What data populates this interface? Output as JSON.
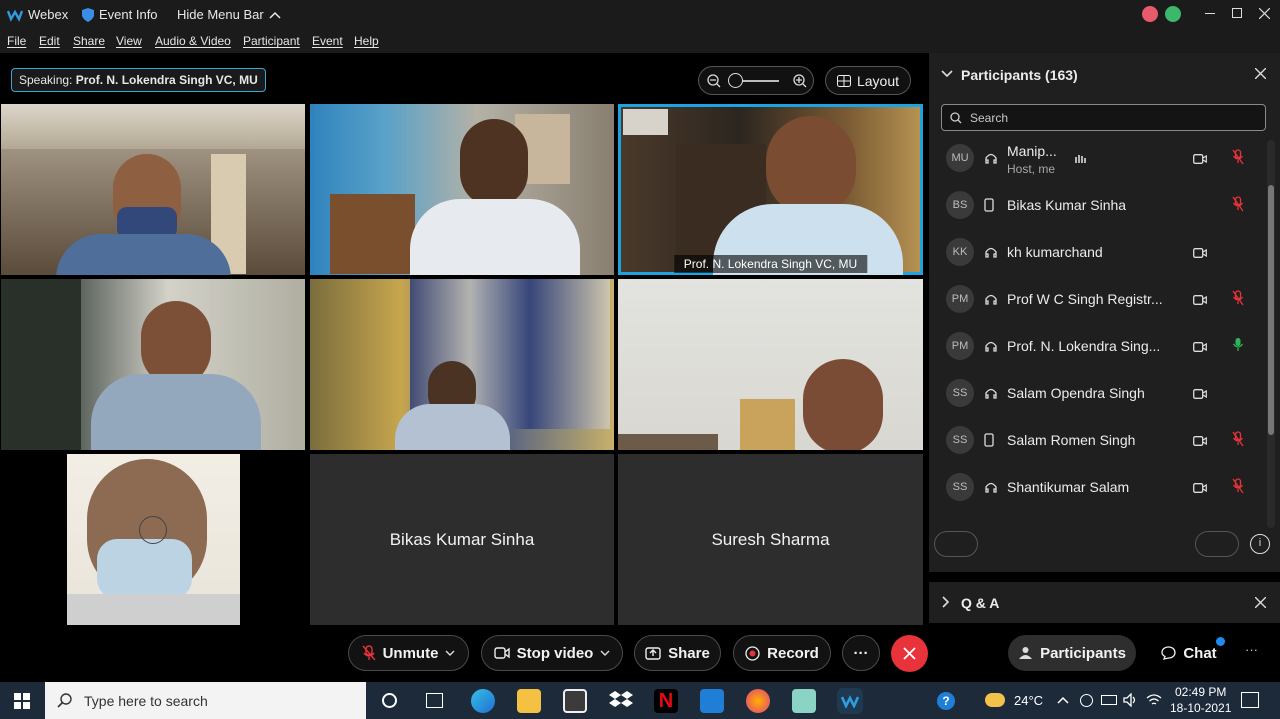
{
  "titlebar": {
    "app_name": "Webex",
    "event_info": "Event Info",
    "hide_menu": "Hide Menu Bar"
  },
  "menu": [
    "File",
    "Edit",
    "Share",
    "View",
    "Audio & Video",
    "Participant",
    "Event",
    "Help"
  ],
  "stage": {
    "speaking_label": "Speaking:",
    "speaking_name": "Prof. N. Lokendra Singh VC, MU",
    "layout_label": "Layout",
    "active_caption": "Prof. N. Lokendra Singh VC, MU",
    "tile_names": [
      "Bikas Kumar Sinha",
      "Suresh Sharma"
    ]
  },
  "participants": {
    "title": "Participants (163)",
    "search_placeholder": "Search",
    "list": [
      {
        "initials": "MU",
        "name": "Manip...",
        "sub": "Host, me",
        "device": "headset",
        "camera": true,
        "mic": "muted"
      },
      {
        "initials": "BS",
        "name": "Bikas Kumar Sinha",
        "sub": "",
        "device": "phone",
        "camera": false,
        "mic": "muted"
      },
      {
        "initials": "KK",
        "name": "kh kumarchand",
        "sub": "",
        "device": "headset",
        "camera": true,
        "mic": "none"
      },
      {
        "initials": "PM",
        "name": "Prof W C Singh Registr...",
        "sub": "",
        "device": "headset",
        "camera": true,
        "mic": "muted"
      },
      {
        "initials": "PM",
        "name": "Prof. N. Lokendra Sing...",
        "sub": "",
        "device": "headset",
        "camera": true,
        "mic": "active"
      },
      {
        "initials": "SS",
        "name": "Salam Opendra Singh",
        "sub": "",
        "device": "headset",
        "camera": true,
        "mic": "none"
      },
      {
        "initials": "SS",
        "name": "Salam Romen Singh",
        "sub": "",
        "device": "phone",
        "camera": true,
        "mic": "muted"
      },
      {
        "initials": "SS",
        "name": "Shantikumar Salam",
        "sub": "",
        "device": "headset",
        "camera": true,
        "mic": "muted"
      }
    ]
  },
  "qa": {
    "title": "Q & A"
  },
  "controls": {
    "unmute": "Unmute",
    "stop_video": "Stop video",
    "share": "Share",
    "record": "Record",
    "more": "···",
    "participants": "Participants",
    "chat": "Chat"
  },
  "taskbar": {
    "search_placeholder": "Type here to search",
    "temperature": "24°C",
    "time": "02:49 PM",
    "date": "18-10-2021"
  },
  "colors": {
    "accent_blue": "#1ba4e0",
    "end_red": "#e8333a",
    "mic_muted": "#e8333a",
    "mic_active": "#2fb45a"
  }
}
